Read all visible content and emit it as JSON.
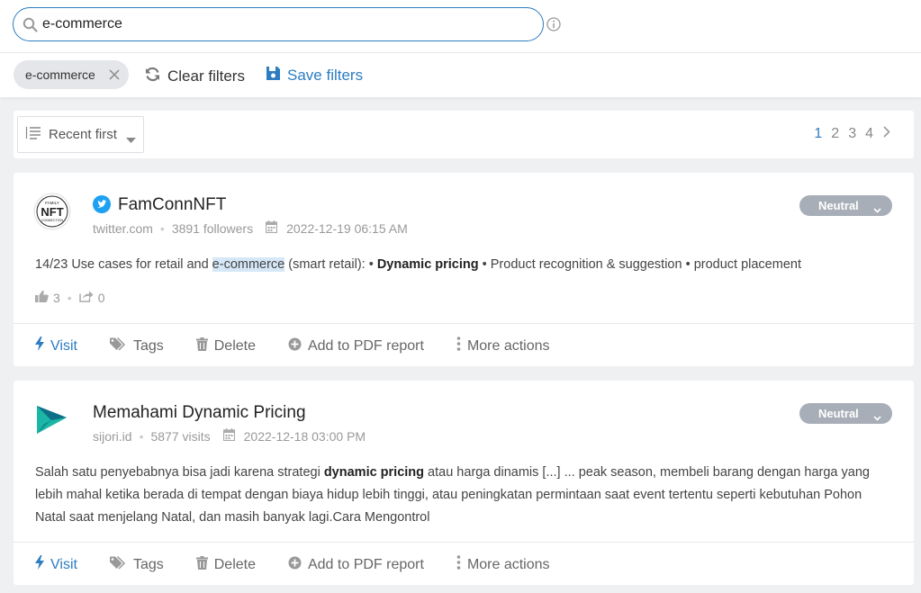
{
  "search": {
    "value": "e-commerce",
    "placeholder": ""
  },
  "filters": {
    "chip": "e-commerce",
    "clear_label": "Clear filters",
    "save_label": "Save filters"
  },
  "sort": {
    "label": "Recent first"
  },
  "pagination": {
    "pages": [
      "1",
      "2",
      "3",
      "4"
    ],
    "active": "1"
  },
  "colors": {
    "accent": "#2d7cc1",
    "neutral_badge": "#a8aeb7",
    "twitter": "#1da1f2"
  },
  "results": [
    {
      "avatar_text": [
        "FAMILY",
        "NFT",
        "CONNECTION"
      ],
      "source_icon": "twitter-icon",
      "title": "FamConnNFT",
      "source": "twitter.com",
      "audience": "3891 followers",
      "date": "2022-12-19 06:15 AM",
      "sentiment": "Neutral",
      "snippet": {
        "before": "14/23 Use cases for retail and ",
        "highlight": "e-commerce",
        "middle": " (smart retail): • ",
        "bold": "Dynamic pricing",
        "after": " • Product recognition & suggestion • product placement"
      },
      "likes": "3",
      "shares": "0"
    },
    {
      "avatar_icon": "sijori-logo-icon",
      "title": "Memahami Dynamic Pricing",
      "source": "sijori.id",
      "audience": "5877 visits",
      "date": "2022-12-18 03:00 PM",
      "sentiment": "Neutral",
      "snippet": {
        "before": "Salah satu penyebabnya bisa jadi karena strategi ",
        "bold": "dynamic pricing",
        "after": " atau harga dinamis [...] ... peak season, membeli barang dengan harga yang lebih mahal ketika berada di tempat dengan biaya hidup lebih tinggi, atau peningkatan permintaan saat event tertentu seperti kebutuhan Pohon Natal saat menjelang Natal, dan masih banyak lagi.Cara Mengontrol"
      }
    }
  ],
  "actions": {
    "visit": "Visit",
    "tags": "Tags",
    "delete": "Delete",
    "pdf": "Add to PDF report",
    "more": "More actions"
  }
}
